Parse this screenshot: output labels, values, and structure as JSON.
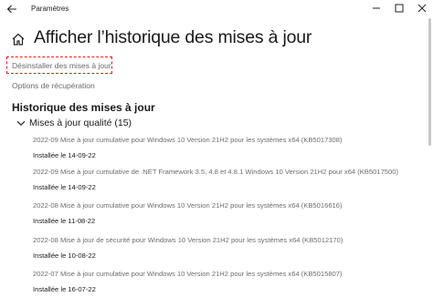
{
  "window": {
    "title": "Paramètres"
  },
  "page": {
    "title": "Afficher l’historique des mises à jour"
  },
  "links": {
    "uninstall": "Désinstaller des mises à jour",
    "recovery": "Options de récupération"
  },
  "history": {
    "section_title": "Historique des mises à jour",
    "group_label": "Mises à jour qualité (15)",
    "items": [
      {
        "name": "2022-09 Mise à jour cumulative pour Windows 10 Version 21H2 pour les systèmes x64 (KB5017308)",
        "status": "Installée le 14-09-22"
      },
      {
        "name": "2022-09 Mise à jour cumulative de .NET Framework 3.5, 4.8 et 4.8.1 Windows 10 Version 21H2 pour x64 (KB5017500)",
        "status": "Installée le 14-09-22"
      },
      {
        "name": "2022-08 Mise à jour cumulative pour Windows 10 Version 21H2 pour les systèmes x64 (KB5016616)",
        "status": "Installée le 11-08-22"
      },
      {
        "name": "2022-08 Mise à jour de sécurité pour Windows 10 Version 21H2 pour les systèmes x64 (KB5012170)",
        "status": "Installée le 10-08-22"
      },
      {
        "name": "2022-07 Mise à jour cumulative pour Windows 10 Version 21H2 pour les systèmes x64 (KB5015807)",
        "status": "Installée le 16-07-22"
      }
    ]
  },
  "colors": {
    "highlight_box": "#e02020",
    "link_text": "#6d6d6d",
    "background": "#ffffff"
  }
}
